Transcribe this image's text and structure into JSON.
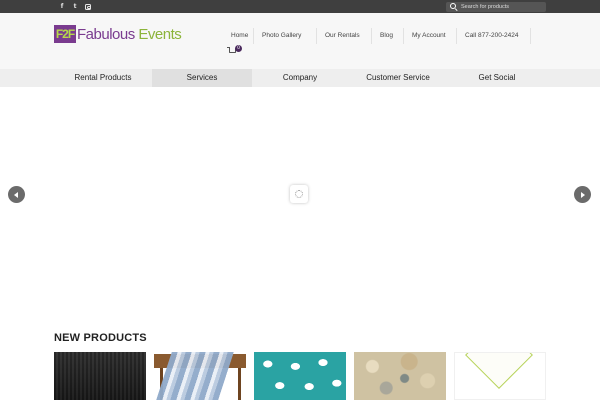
{
  "topbar": {
    "social": [
      {
        "name": "facebook-icon",
        "glyph": "f"
      },
      {
        "name": "twitter-icon",
        "glyph": "t"
      },
      {
        "name": "instagram-icon",
        "glyph": ""
      }
    ],
    "search": {
      "placeholder": "Search for products"
    }
  },
  "header": {
    "logo": {
      "mark": "F2F",
      "text_primary": "Fabulous",
      "text_secondary": "Events"
    },
    "nav": [
      {
        "label": "Home"
      },
      {
        "label": "Photo Gallery"
      },
      {
        "label": "Our Rentals"
      },
      {
        "label": "Blog"
      },
      {
        "label": "My Account"
      },
      {
        "label": "Call 877-200-2424"
      }
    ],
    "cart": {
      "count": "0"
    }
  },
  "categories": [
    {
      "label": "Rental Products"
    },
    {
      "label": "Services"
    },
    {
      "label": "Company"
    },
    {
      "label": "Customer Service"
    },
    {
      "label": "Get Social"
    }
  ],
  "slider": {
    "prev_icon": "chevron-left-icon",
    "next_icon": "chevron-right-icon",
    "loader_icon": "spinner-icon"
  },
  "new_products": {
    "title": "NEW PRODUCTS",
    "items": [
      {
        "name": "black linen"
      },
      {
        "name": "striped table runner"
      },
      {
        "name": "teal patterned linen"
      },
      {
        "name": "granite print linen"
      },
      {
        "name": "white napkin with green trim"
      }
    ]
  },
  "colors": {
    "topbar": "#3f3f3f",
    "brand_purple": "#7a3b8f",
    "brand_green": "#8cb43a",
    "catbar": "#eeeeee"
  }
}
